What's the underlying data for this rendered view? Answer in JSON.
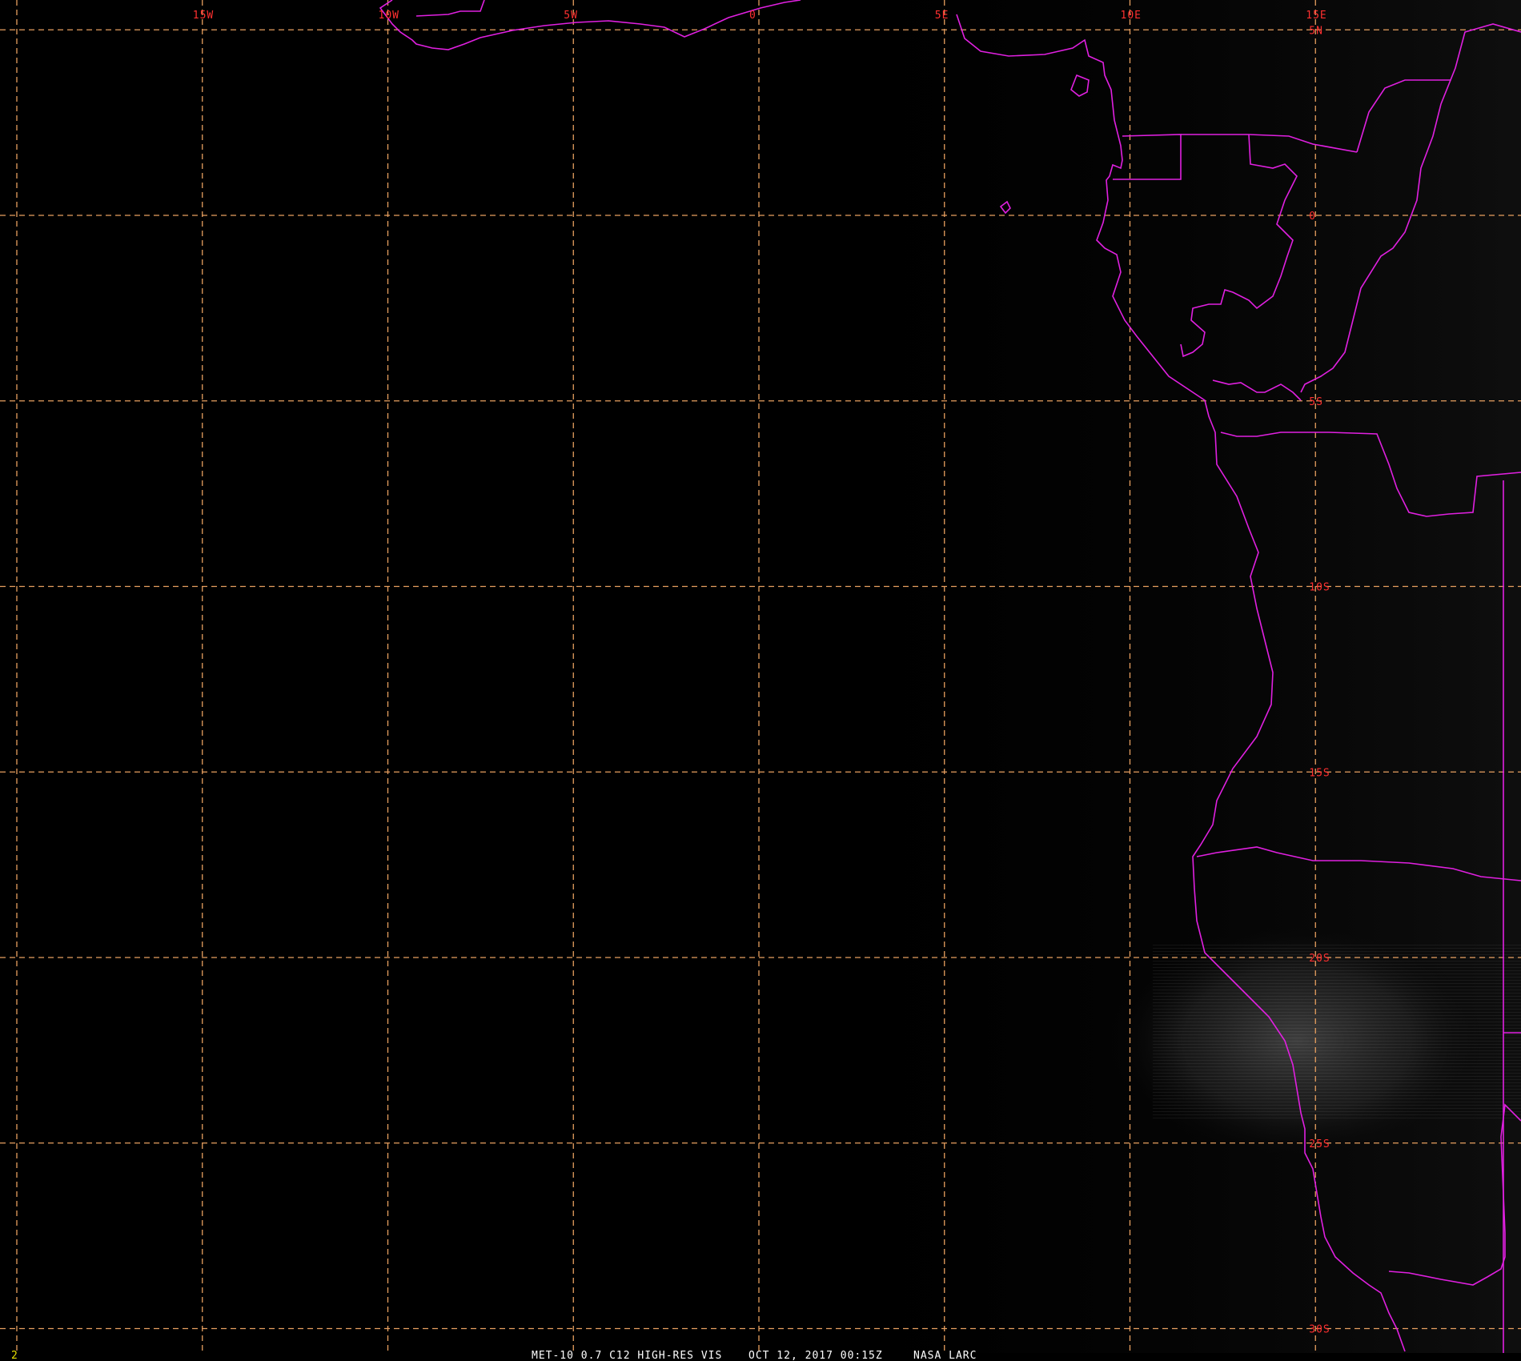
{
  "colors": {
    "background": "#000000",
    "grid": "#e8a060",
    "tick_label": "#ff3030",
    "coastline": "#e020e0",
    "footer_text": "#ffffff",
    "frame_number": "#e8e000"
  },
  "map": {
    "projection": "lat-lon",
    "lon_labels": [
      "15W",
      "10W",
      "5W",
      "0",
      "5E",
      "10E",
      "15E"
    ],
    "lon_values": [
      -15,
      -10,
      -5,
      0,
      5,
      10,
      15
    ],
    "lat_labels": [
      "5N",
      "0",
      "5S",
      "10S",
      "15S",
      "20S",
      "25S",
      "30S"
    ],
    "lat_values": [
      5,
      0,
      -5,
      -10,
      -15,
      -20,
      -25,
      -30
    ]
  },
  "footer": {
    "frame_number": "2",
    "product": "MET-10 0.7 C12 HIGH-RES VIS",
    "datetime": "OCT 12, 2017 00:15Z",
    "source": "NASA LARC"
  }
}
